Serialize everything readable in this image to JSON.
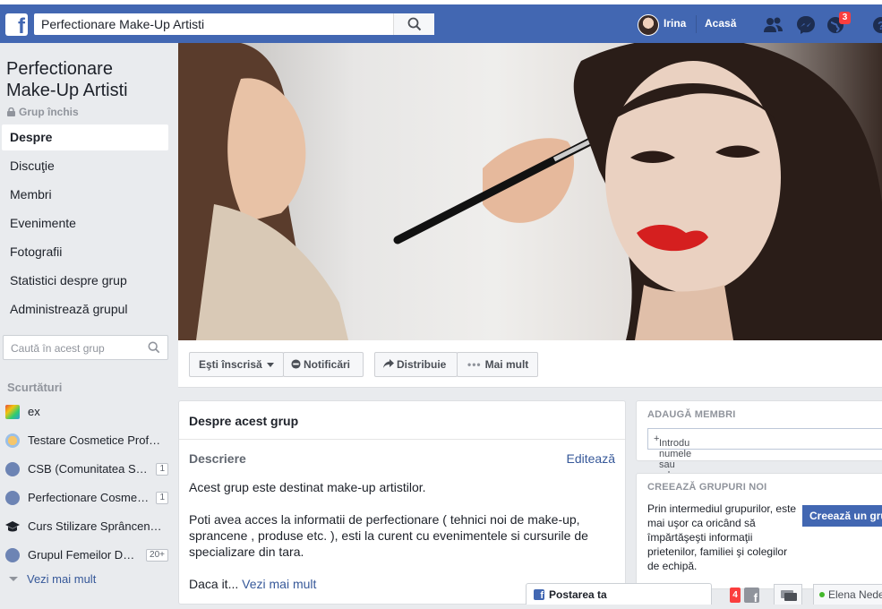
{
  "topbar": {
    "search_value": "Perfectionare Make-Up Artisti",
    "user_name": "Irina",
    "home_label": "Acasă",
    "notifications_count": "3"
  },
  "group": {
    "title_line1": "Perfectionare",
    "title_line2": "Make-Up Artisti",
    "privacy": "Grup închis"
  },
  "nav": [
    "Despre",
    "Discuţie",
    "Membri",
    "Evenimente",
    "Fotografii",
    "Statistici despre grup",
    "Administrează grupul"
  ],
  "left_search_placeholder": "Caută în acest grup",
  "shortcuts": {
    "heading": "Scurtături",
    "items": [
      {
        "label": "ex",
        "count": ""
      },
      {
        "label": "Testare Cosmetice Prof…",
        "count": ""
      },
      {
        "label": "CSB (Comunitatea S…",
        "count": "1"
      },
      {
        "label": "Perfectionare Cosme…",
        "count": "1"
      },
      {
        "label": "Curs Stilizare Sprâncen…",
        "count": ""
      },
      {
        "label": "Grupul Femeilor D…",
        "count": "20+"
      }
    ],
    "see_more": "Vezi mai mult"
  },
  "actions": {
    "joined": "Eşti înscrisă",
    "notifications": "Notificări",
    "share": "Distribuie",
    "more": "Mai mult"
  },
  "about": {
    "heading": "Despre acest grup",
    "description_heading": "Descriere",
    "edit": "Editează",
    "para1": "Acest grup este destinat make-up artistilor.",
    "para2": "Poti avea acces la informatii de perfectionare ( tehnici noi de make-up, sprancene , produse etc. ), esti la curent cu evenimentele si cursurile de specializare din tara.",
    "para3_start": "Daca it...",
    "see_more": "Vezi mai mult"
  },
  "add_members": {
    "heading": "ADAUGĂ MEMBRI",
    "placeholder": "Introdu numele sau adresa de e-mail..."
  },
  "create_group": {
    "heading": "CREEAZĂ GRUPURI NOI",
    "text": "Prin intermediul grupurilor, este mai uşor ca oricând să împărtăşeşti informaţii prietenilor, familiei şi colegilor de echipă.",
    "button": "Creează un grup"
  },
  "chat": {
    "post_label": "Postarea ta",
    "badge": "4",
    "friend_name": "Elena Nedelcu"
  },
  "colors": {
    "brand_blue": "#4267b2",
    "link": "#365899",
    "badge_red": "#fa3e3e"
  }
}
